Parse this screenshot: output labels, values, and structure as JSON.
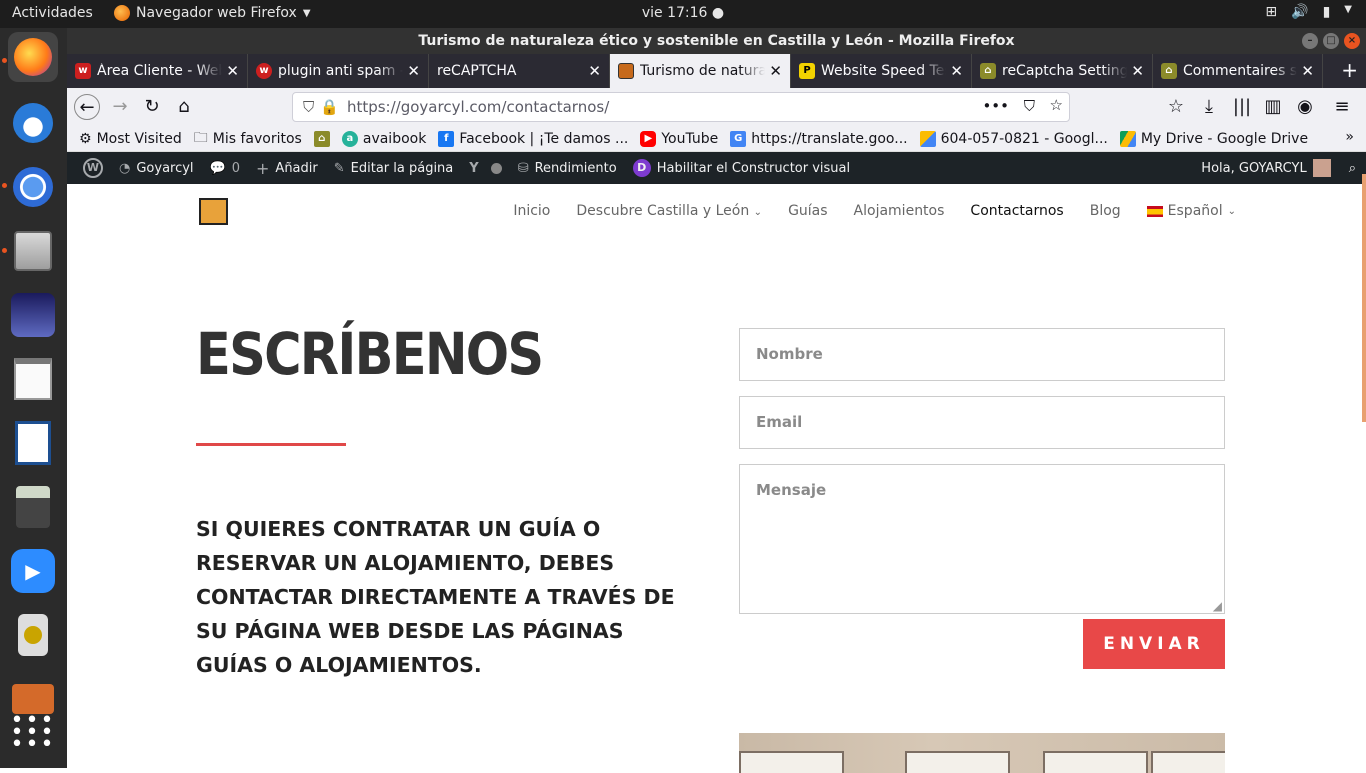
{
  "system": {
    "activities": "Actividades",
    "app_name": "Navegador web Firefox",
    "clock": "vie 17:16"
  },
  "window": {
    "title": "Turismo de naturaleza ético y sostenible en Castilla y León - Mozilla Firefox"
  },
  "tabs": [
    {
      "label": "Área Cliente - Web",
      "icon_color": "#cc1f1f"
    },
    {
      "label": "plugin anti spam - ",
      "icon_color": "#cc1f1f"
    },
    {
      "label": "reCAPTCHA",
      "icon_color": ""
    },
    {
      "label": "Turismo de naturaleza",
      "icon_color": "#c76a1c"
    },
    {
      "label": "Website Speed Test",
      "icon_color": "#f2d200"
    },
    {
      "label": "reCaptcha Settings",
      "icon_color": "#8b8b2a"
    },
    {
      "label": "Commentaires sur",
      "icon_color": "#8b8b2a"
    }
  ],
  "url": {
    "host": "https://goyarcyl.com",
    "path": "/contactarnos/"
  },
  "bookmarks": [
    {
      "label": "Most Visited",
      "icon": "gear-icon"
    },
    {
      "label": "Mis favoritos",
      "icon": "folder-icon"
    },
    {
      "label": "",
      "icon": "site-icon"
    },
    {
      "label": "avaibook",
      "icon": "avaibook-icon"
    },
    {
      "label": "Facebook | ¡Te damos ...",
      "icon": "facebook-icon"
    },
    {
      "label": "YouTube",
      "icon": "youtube-icon"
    },
    {
      "label": "https://translate.goo...",
      "icon": "translate-icon"
    },
    {
      "label": "604-057-0821 - Googl...",
      "icon": "google-ads-icon"
    },
    {
      "label": "My Drive - Google Drive",
      "icon": "drive-icon"
    }
  ],
  "wp_admin": {
    "site": "Goyarcyl",
    "comments": "0",
    "add": "Añadir",
    "edit": "Editar la página",
    "performance": "Rendimiento",
    "builder": "Habilitar el Constructor visual",
    "greeting": "Hola, GOYARCYL"
  },
  "nav": {
    "items": [
      "Inicio",
      "Descubre Castilla y León",
      "Guías",
      "Alojamientos",
      "Contactarnos",
      "Blog",
      "Español"
    ]
  },
  "page": {
    "heading": "ESCRÍBENOS",
    "paragraph": "SI QUIERES CONTRATAR UN GUÍA O RESERVAR UN ALOJAMIENTO, DEBES CONTACTAR DIRECTAMENTE A TRAVÉS DE SU PÁGINA WEB DESDE LAS PÁGINAS GUÍAS O ALOJAMIENTOS.",
    "form": {
      "name_placeholder": "Nombre",
      "email_placeholder": "Email",
      "message_placeholder": "Mensaje",
      "submit": "ENVIAR"
    }
  },
  "colors": {
    "accent": "#e84848",
    "wp_bar": "#1d2327"
  }
}
